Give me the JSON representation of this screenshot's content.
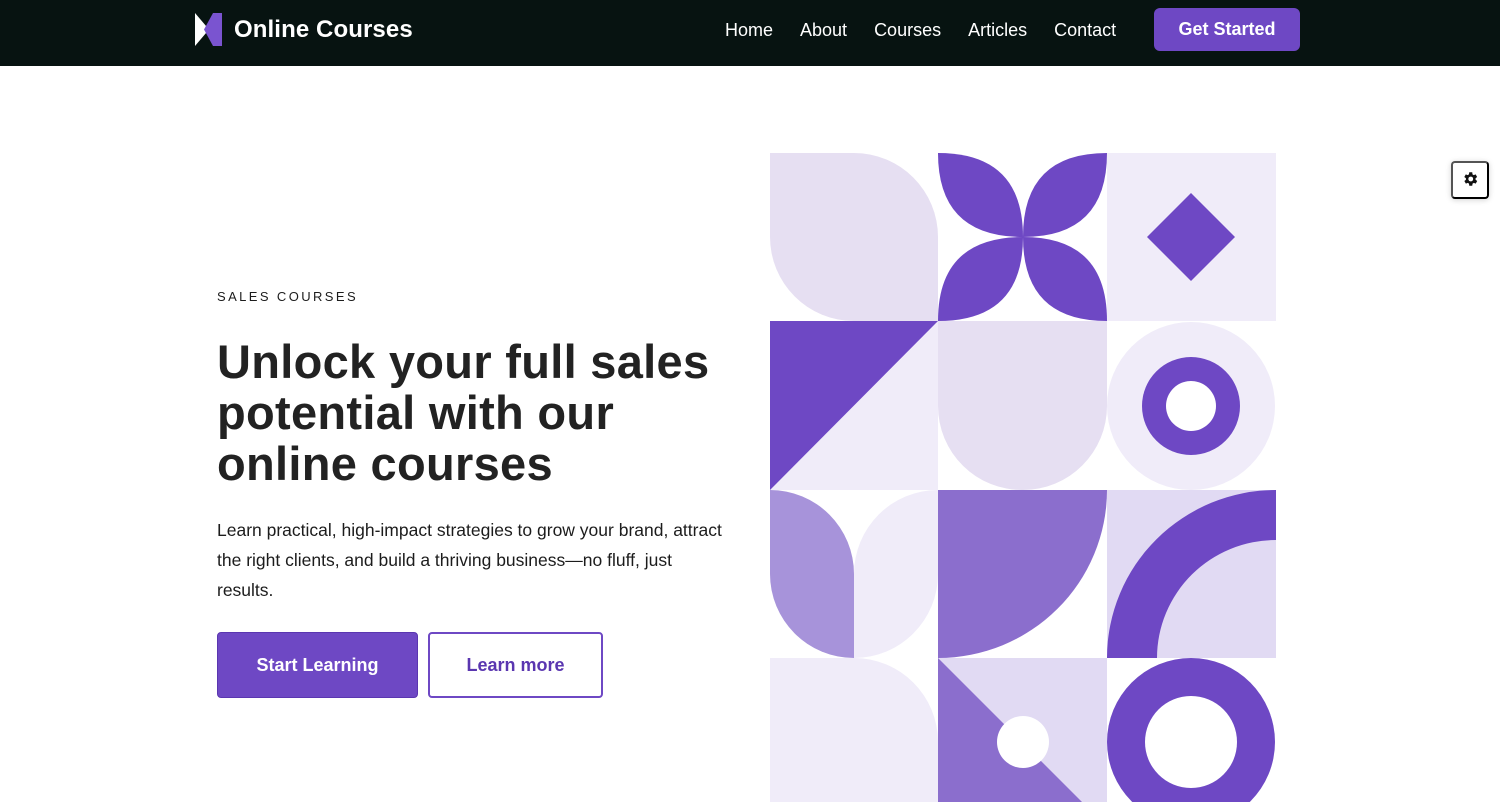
{
  "header": {
    "brand": "Online Courses",
    "nav": [
      "Home",
      "About",
      "Courses",
      "Articles",
      "Contact"
    ],
    "cta": "Get Started"
  },
  "hero": {
    "eyebrow": "SALES COURSES",
    "headline": "Unlock your full sales potential with our online courses",
    "subtext": "Learn practical, high-impact strategies to grow your brand, attract the right clients, and build a thriving business—no fluff, just results.",
    "primary_button": "Start Learning",
    "secondary_button": "Learn more"
  },
  "icons": {
    "logo": "logo-icon",
    "settings": "gear-icon"
  },
  "colors": {
    "header_bg": "#071311",
    "accent": "#6e48c4",
    "accent_mid": "#8b6ecd",
    "accent_soft": "#a793da",
    "lavender": "#e6dff2",
    "lavender_light": "#f0ecf9",
    "text": "#222222"
  }
}
